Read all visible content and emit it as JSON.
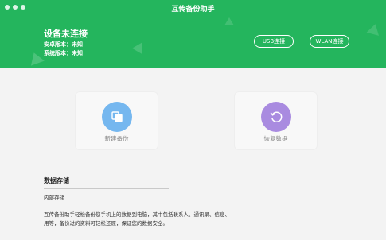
{
  "window": {
    "title": "互传备份助手"
  },
  "header": {
    "status_title": "设备未连接",
    "android_version": "安卓版本：未知",
    "system_version": "系统版本：未知",
    "usb_button": "USB连接",
    "wlan_button": "WLAN连接"
  },
  "actions": {
    "backup_label": "新建备份",
    "restore_label": "恢复数据",
    "backup_color": "#75b7ef",
    "restore_color": "#a98be0"
  },
  "storage": {
    "title": "数据存储",
    "subtitle": "内部存储",
    "description_line1": "互传备份助手轻松备份您手机上的数据到电脑，其中包括联系人、通讯录、信息、",
    "description_line2": "用等，备份过的资料可轻松还原，保证您的数据安全。"
  },
  "colors": {
    "brand_green": "#24b55d"
  }
}
